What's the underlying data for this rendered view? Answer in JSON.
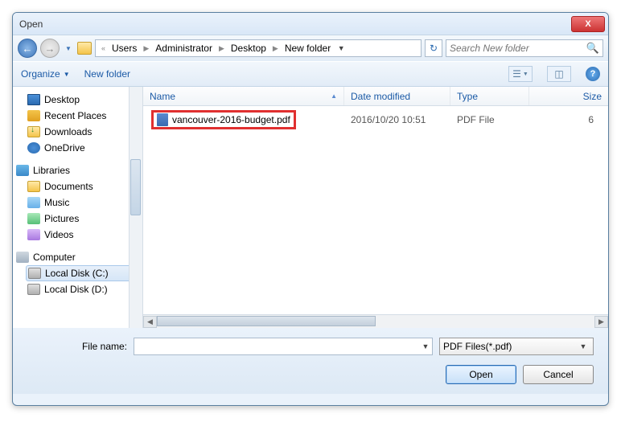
{
  "window": {
    "title": "Open"
  },
  "breadcrumb": {
    "segments": [
      "Users",
      "Administrator",
      "Desktop",
      "New folder"
    ]
  },
  "search": {
    "placeholder": "Search New folder"
  },
  "toolbar": {
    "organize": "Organize",
    "newfolder": "New folder"
  },
  "sidebar": {
    "favorites": [
      {
        "label": "Desktop"
      },
      {
        "label": "Recent Places"
      },
      {
        "label": "Downloads"
      },
      {
        "label": "OneDrive"
      }
    ],
    "libraries_header": "Libraries",
    "libraries": [
      {
        "label": "Documents"
      },
      {
        "label": "Music"
      },
      {
        "label": "Pictures"
      },
      {
        "label": "Videos"
      }
    ],
    "computer_header": "Computer",
    "drives": [
      {
        "label": "Local Disk (C:)"
      },
      {
        "label": "Local Disk (D:)"
      }
    ]
  },
  "columns": {
    "name": "Name",
    "date": "Date modified",
    "type": "Type",
    "size": "Size"
  },
  "files": [
    {
      "name": "vancouver-2016-budget.pdf",
      "date": "2016/10/20 10:51",
      "type": "PDF File",
      "size": "6"
    }
  ],
  "footer": {
    "filename_label": "File name:",
    "filename_value": "",
    "filter": "PDF Files(*.pdf)",
    "open": "Open",
    "cancel": "Cancel"
  }
}
